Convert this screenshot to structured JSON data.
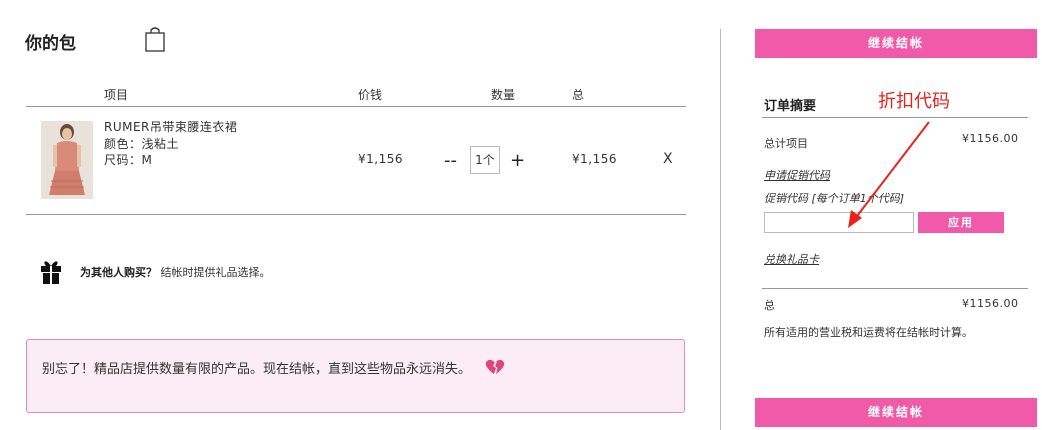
{
  "bag": {
    "title": "你的包",
    "columns": {
      "item": "项目",
      "price": "价钱",
      "qty": "数量",
      "total": "总"
    },
    "item": {
      "name": "RUMER吊带束腰连衣裙",
      "color": "颜色：浅粘土",
      "size": "尺码：M",
      "price": "¥1,156",
      "minus": "--",
      "qty": "1个",
      "plus": "+",
      "total": "¥1,156",
      "remove": "X"
    },
    "gift": {
      "bold": "为其他人购买？",
      "text": "结帐时提供礼品选择。"
    },
    "notice": "别忘了！精品店提供数量有限的产品。现在结帐，直到这些物品永远消失。"
  },
  "summary": {
    "checkout_top": "继续结帐",
    "title": "订单摘要",
    "annotation": "折扣代码",
    "subtotal_label": "总计项目",
    "subtotal_value": "¥1156.00",
    "apply_promo_link": "申请促销代码",
    "promo_label": "促销代码 [每个订单1个代码]",
    "promo_placeholder": "",
    "apply_button": "应用",
    "gift_card_link": "兑换礼品卡",
    "total_label": "总",
    "total_value": "¥1156.00",
    "tax_note": "所有适用的营业税和运费将在结帐时计算。",
    "checkout_bottom": "继续结帐"
  },
  "colors": {
    "accent": "#f05aa8",
    "annotation": "#e8221b",
    "notice_bg": "#fcecf5"
  },
  "icons": [
    "shopping-bag-icon",
    "gift-icon",
    "broken-heart-icon",
    "red-arrow-annotation"
  ]
}
